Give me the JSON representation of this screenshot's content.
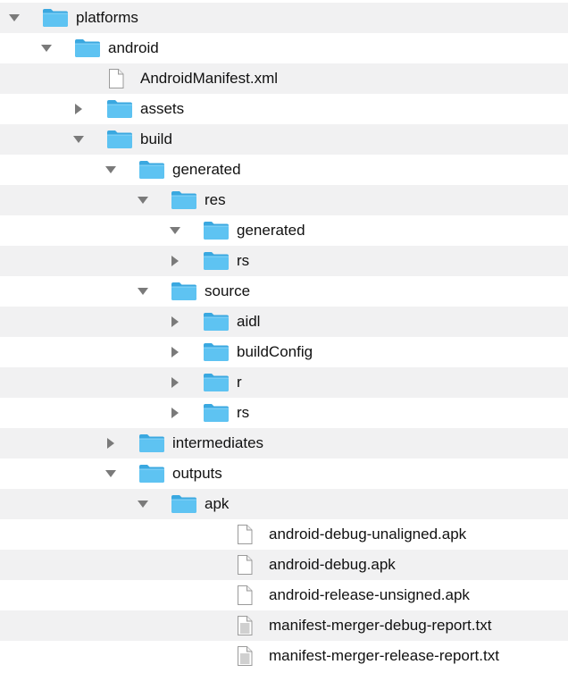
{
  "tree": {
    "rows": [
      {
        "label": "platforms",
        "kind": "folder",
        "state": "expanded",
        "depth": 0
      },
      {
        "label": "android",
        "kind": "folder",
        "state": "expanded",
        "depth": 1
      },
      {
        "label": "AndroidManifest.xml",
        "kind": "file",
        "state": "none",
        "depth": 2
      },
      {
        "label": "assets",
        "kind": "folder",
        "state": "collapsed",
        "depth": 2
      },
      {
        "label": "build",
        "kind": "folder",
        "state": "expanded",
        "depth": 2
      },
      {
        "label": "generated",
        "kind": "folder",
        "state": "expanded",
        "depth": 3
      },
      {
        "label": "res",
        "kind": "folder",
        "state": "expanded",
        "depth": 4
      },
      {
        "label": "generated",
        "kind": "folder",
        "state": "expanded",
        "depth": 5
      },
      {
        "label": "rs",
        "kind": "folder",
        "state": "collapsed",
        "depth": 5
      },
      {
        "label": "source",
        "kind": "folder",
        "state": "expanded",
        "depth": 4
      },
      {
        "label": "aidl",
        "kind": "folder",
        "state": "collapsed",
        "depth": 5
      },
      {
        "label": "buildConfig",
        "kind": "folder",
        "state": "collapsed",
        "depth": 5
      },
      {
        "label": "r",
        "kind": "folder",
        "state": "collapsed",
        "depth": 5
      },
      {
        "label": "rs",
        "kind": "folder",
        "state": "collapsed",
        "depth": 5
      },
      {
        "label": "intermediates",
        "kind": "folder",
        "state": "collapsed",
        "depth": 3
      },
      {
        "label": "outputs",
        "kind": "folder",
        "state": "expanded",
        "depth": 3
      },
      {
        "label": "apk",
        "kind": "folder",
        "state": "expanded",
        "depth": 4
      },
      {
        "label": "android-debug-unaligned.apk",
        "kind": "file",
        "state": "none",
        "depth": 6
      },
      {
        "label": "android-debug.apk",
        "kind": "file",
        "state": "none",
        "depth": 6
      },
      {
        "label": "android-release-unsigned.apk",
        "kind": "file",
        "state": "none",
        "depth": 6
      },
      {
        "label": "manifest-merger-debug-report.txt",
        "kind": "text-file",
        "state": "none",
        "depth": 6
      },
      {
        "label": "manifest-merger-release-report.txt",
        "kind": "text-file",
        "state": "none",
        "depth": 6
      }
    ]
  },
  "colors": {
    "folder_body": "#5ec3f2",
    "folder_tab": "#3aa8e0",
    "stripe": "#f1f1f2",
    "triangle": "#7a7a7a",
    "text": "#111111"
  },
  "icons": {
    "folder": "folder-icon",
    "file": "document-icon",
    "text_file": "text-document-icon",
    "expanded": "disclosure-triangle-down-icon",
    "collapsed": "disclosure-triangle-right-icon"
  }
}
